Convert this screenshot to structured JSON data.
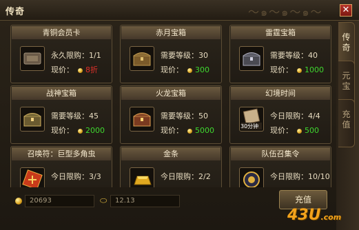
{
  "window": {
    "title": "传奇",
    "close_label": "✕"
  },
  "side_tabs": [
    {
      "label": "传奇",
      "active": true
    },
    {
      "label": "元宝",
      "active": false
    },
    {
      "label": "充值",
      "active": false
    }
  ],
  "items": [
    {
      "name": "青铜会员卡",
      "line1": "永久限购：1/1",
      "price_label": "现价：",
      "price": "8折",
      "price_color": "red",
      "icon": "vip-card-icon"
    },
    {
      "name": "赤月宝箱",
      "line1": "需要等级：30",
      "price_label": "现价：",
      "price": "300",
      "price_color": "green",
      "icon": "treasure-chest-icon"
    },
    {
      "name": "雷霆宝箱",
      "line1": "需要等级：40",
      "price_label": "现价：",
      "price": "1000",
      "price_color": "green",
      "icon": "silver-chest-icon"
    },
    {
      "name": "战神宝箱",
      "line1": "需要等级：45",
      "price_label": "现价：",
      "price": "2000",
      "price_color": "green",
      "icon": "gold-chest-icon"
    },
    {
      "name": "火龙宝箱",
      "line1": "需要等级：50",
      "price_label": "现价：",
      "price": "5000",
      "price_color": "green",
      "icon": "dragon-chest-icon"
    },
    {
      "name": "幻境时间",
      "line1": "今日限购：4/4",
      "price_label": "现价：",
      "price": "500",
      "price_color": "green",
      "icon": "time-scroll-icon",
      "icon_text": "30分钟"
    },
    {
      "name": "召唤符：巨型多角虫",
      "line1": "今日限购：3/3",
      "icon": "summon-talisman-icon"
    },
    {
      "name": "金条",
      "line1": "今日限购：2/2",
      "icon": "gold-bar-icon"
    },
    {
      "name": "队伍召集令",
      "line1": "今日限购：10/10",
      "icon": "team-summon-icon"
    }
  ],
  "currency": {
    "gold": "20693",
    "yuanbao": "12.13"
  },
  "recharge_label": "充值",
  "watermark": {
    "main": "43U",
    "suffix": ".com"
  },
  "colors": {
    "green_price": "#3fd82f",
    "red_price": "#e0302a",
    "gold": "#d9a01c"
  }
}
